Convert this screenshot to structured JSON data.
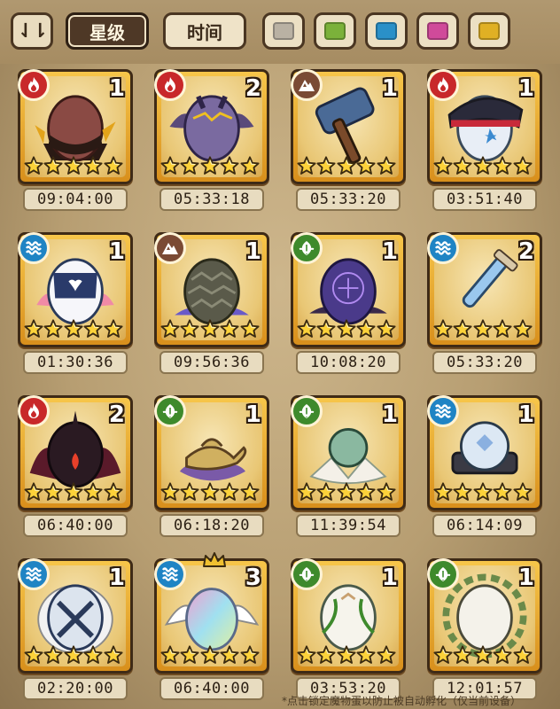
{
  "toolbar": {
    "sort_toggle_label": "⇃⇂",
    "tab_star": "星级",
    "tab_time": "时间",
    "color_filters": [
      {
        "name": "grey",
        "color": "#b9b1a3"
      },
      {
        "name": "green",
        "color": "#7bb13a"
      },
      {
        "name": "blue",
        "color": "#2a90c8"
      },
      {
        "name": "pink",
        "color": "#d04a9a"
      },
      {
        "name": "yellow",
        "color": "#e0b024"
      }
    ]
  },
  "element_colors": {
    "fire": "#c8282a",
    "earth": "#7a4a34",
    "water": "#1f84c4",
    "nature": "#3e8a2c"
  },
  "eggs": [
    {
      "element": "fire",
      "count": "1",
      "stars": 5,
      "timer": "09:04:00",
      "art": "dark-red-helmet-egg"
    },
    {
      "element": "fire",
      "count": "2",
      "stars": 5,
      "timer": "05:33:18",
      "art": "winged-purple-egg"
    },
    {
      "element": "earth",
      "count": "1",
      "stars": 5,
      "timer": "05:33:20",
      "art": "hammer"
    },
    {
      "element": "fire",
      "count": "1",
      "stars": 5,
      "timer": "03:51:40",
      "art": "captain-hat-egg"
    },
    {
      "element": "water",
      "count": "1",
      "stars": 5,
      "timer": "01:30:36",
      "art": "striped-heart-egg"
    },
    {
      "element": "earth",
      "count": "1",
      "stars": 5,
      "timer": "09:56:36",
      "art": "pinecone-egg"
    },
    {
      "element": "nature",
      "count": "1",
      "stars": 5,
      "timer": "10:08:20",
      "art": "rune-purple-egg"
    },
    {
      "element": "water",
      "count": "2",
      "stars": 5,
      "timer": "05:33:20",
      "art": "sword"
    },
    {
      "element": "fire",
      "count": "2",
      "stars": 5,
      "timer": "06:40:00",
      "art": "demon-wing-egg"
    },
    {
      "element": "nature",
      "count": "1",
      "stars": 5,
      "timer": "06:18:20",
      "art": "magic-lamp"
    },
    {
      "element": "nature",
      "count": "1",
      "stars": 5,
      "timer": "11:39:54",
      "art": "lotus-egg"
    },
    {
      "element": "water",
      "count": "1",
      "stars": 5,
      "timer": "06:14:09",
      "art": "crystal-orb-egg"
    },
    {
      "element": "water",
      "count": "1",
      "stars": 5,
      "timer": "02:20:00",
      "art": "frilled-blue-egg"
    },
    {
      "element": "water",
      "count": "3",
      "stars": 5,
      "timer": "06:40:00",
      "art": "rainbow-angel-egg",
      "crown": true
    },
    {
      "element": "nature",
      "count": "1",
      "stars": 5,
      "timer": "03:53:20",
      "art": "vine-white-egg"
    },
    {
      "element": "nature",
      "count": "1",
      "stars": 5,
      "timer": "12:01:57",
      "art": "olive-wreath-egg"
    }
  ],
  "footer_text": "*点击锁定魔物蛋以防止被自动孵化（仅当前设备）"
}
